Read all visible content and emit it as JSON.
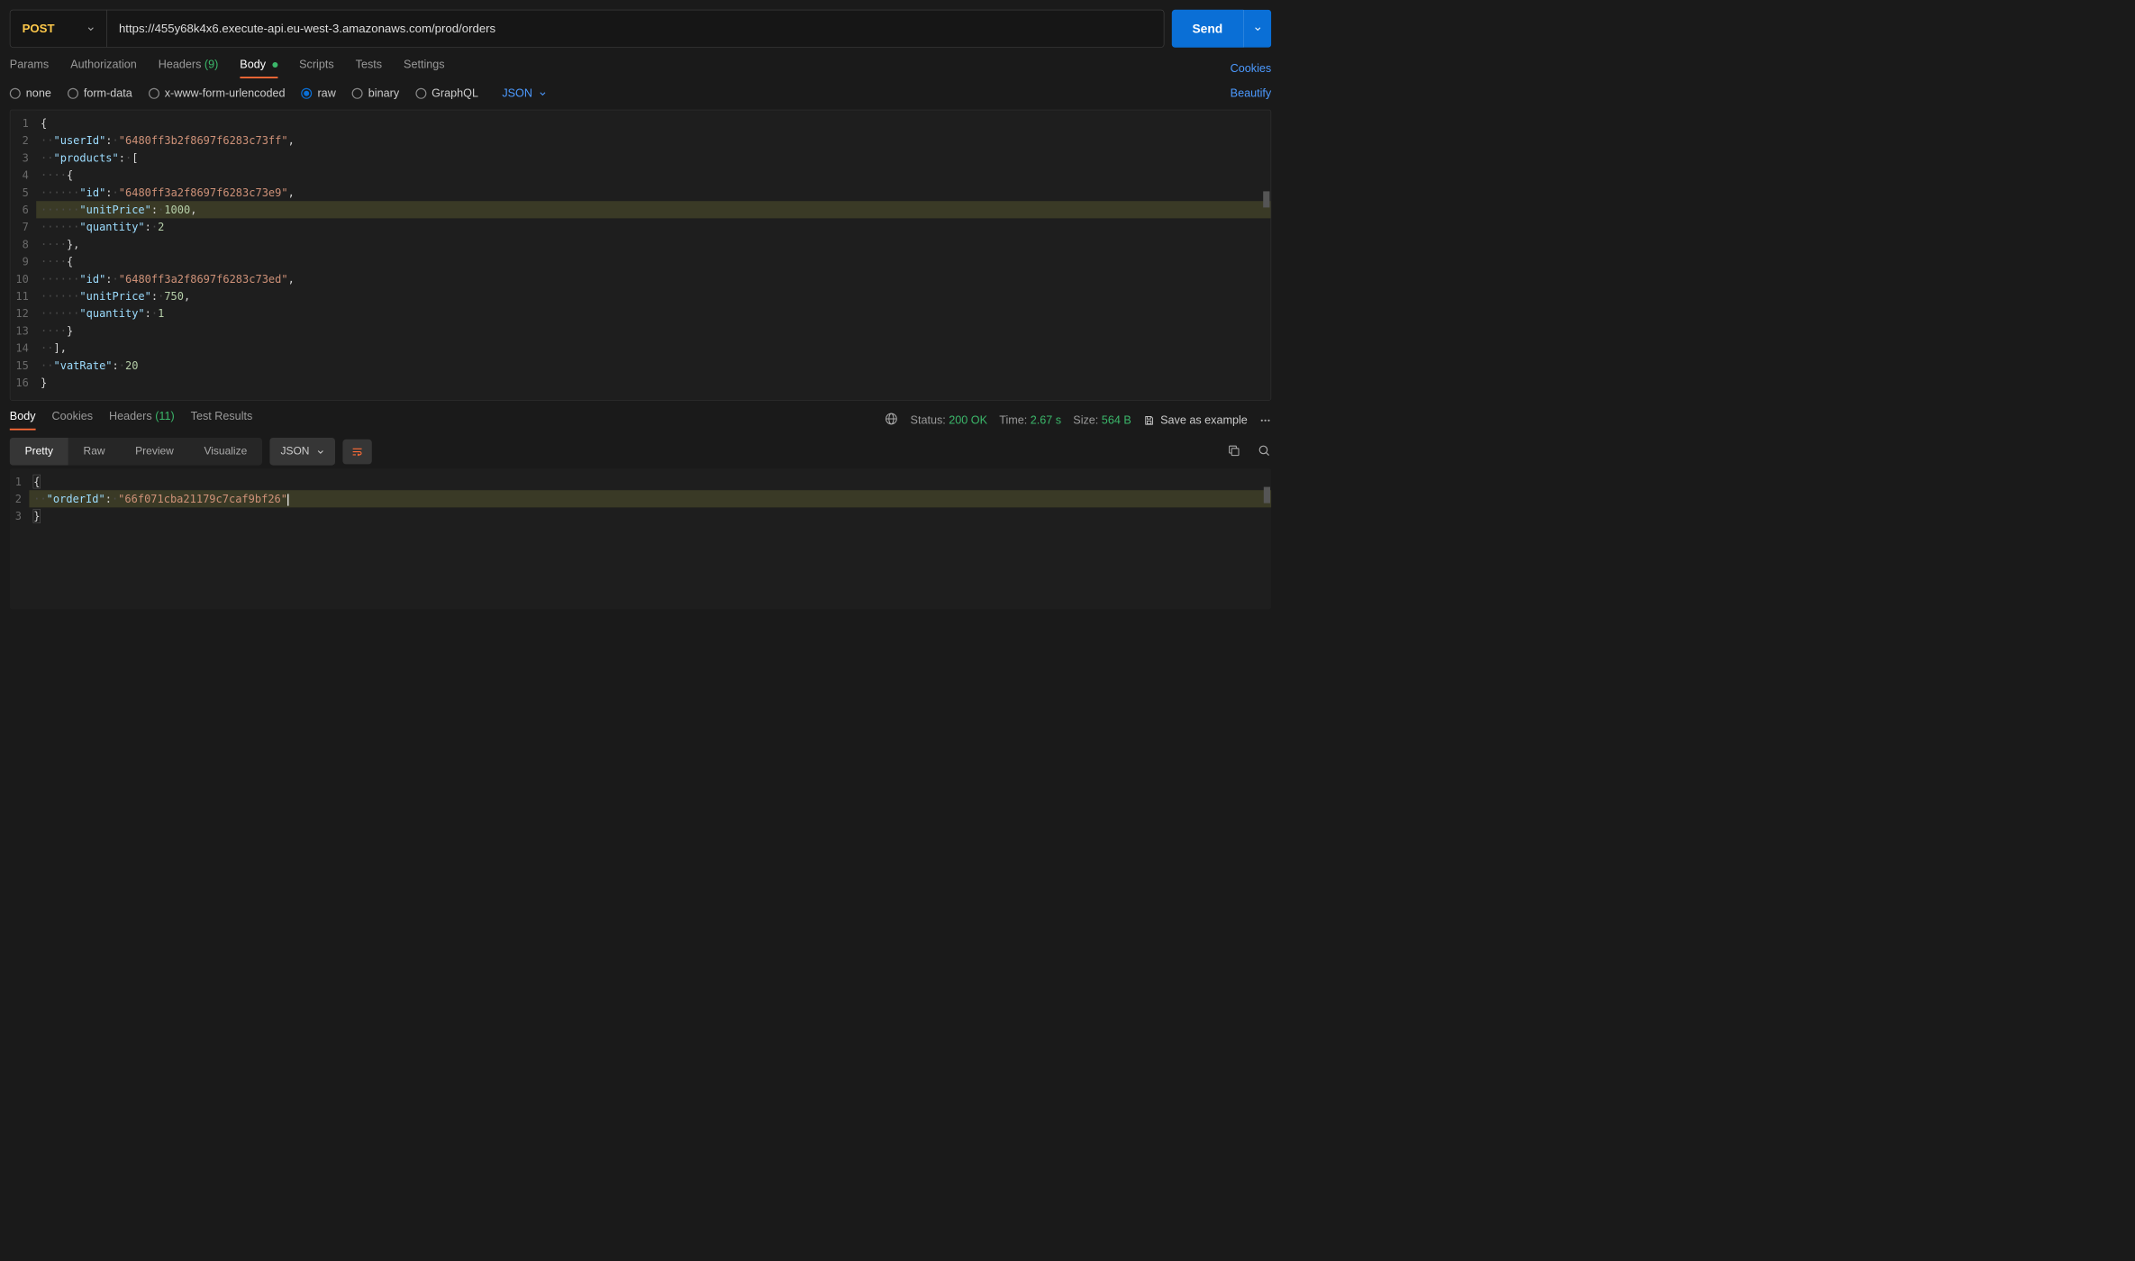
{
  "request": {
    "method": "POST",
    "url": "https://455y68k4x6.execute-api.eu-west-3.amazonaws.com/prod/orders",
    "sendLabel": "Send"
  },
  "requestTabs": {
    "params": "Params",
    "authorization": "Authorization",
    "headers": "Headers",
    "headersCount": "(9)",
    "body": "Body",
    "scripts": "Scripts",
    "tests": "Tests",
    "settings": "Settings",
    "cookiesLink": "Cookies"
  },
  "bodyTypes": {
    "none": "none",
    "formData": "form-data",
    "xwww": "x-www-form-urlencoded",
    "raw": "raw",
    "binary": "binary",
    "graphql": "GraphQL",
    "jsonLabel": "JSON"
  },
  "beautify": "Beautify",
  "requestBodyLines": [
    {
      "n": 1,
      "indent": 0,
      "text": "{",
      "kind": "punc"
    },
    {
      "n": 2,
      "indent": 1,
      "key": "userId",
      "valStr": "6480ff3b2f8697f6283c73ff",
      "comma": true
    },
    {
      "n": 3,
      "indent": 1,
      "key": "products",
      "raw": "[",
      "comma": false
    },
    {
      "n": 4,
      "indent": 2,
      "text": "{",
      "kind": "punc"
    },
    {
      "n": 5,
      "indent": 3,
      "key": "id",
      "valStr": "6480ff3a2f8697f6283c73e9",
      "comma": true
    },
    {
      "n": 6,
      "indent": 3,
      "key": "unitPrice",
      "valNum": "1000",
      "comma": true,
      "hl": true
    },
    {
      "n": 7,
      "indent": 3,
      "key": "quantity",
      "valNum": "2",
      "comma": false
    },
    {
      "n": 8,
      "indent": 2,
      "text": "},",
      "kind": "punc"
    },
    {
      "n": 9,
      "indent": 2,
      "text": "{",
      "kind": "punc"
    },
    {
      "n": 10,
      "indent": 3,
      "key": "id",
      "valStr": "6480ff3a2f8697f6283c73ed",
      "comma": true
    },
    {
      "n": 11,
      "indent": 3,
      "key": "unitPrice",
      "valNum": "750",
      "comma": true
    },
    {
      "n": 12,
      "indent": 3,
      "key": "quantity",
      "valNum": "1",
      "comma": false
    },
    {
      "n": 13,
      "indent": 2,
      "text": "}",
      "kind": "punc"
    },
    {
      "n": 14,
      "indent": 1,
      "text": "],",
      "kind": "punc"
    },
    {
      "n": 15,
      "indent": 1,
      "key": "vatRate",
      "valNum": "20",
      "comma": false
    },
    {
      "n": 16,
      "indent": 0,
      "text": "}",
      "kind": "punc"
    }
  ],
  "responseTabs": {
    "body": "Body",
    "cookies": "Cookies",
    "headers": "Headers",
    "headersCount": "(11)",
    "testResults": "Test Results"
  },
  "status": {
    "statusLabel": "Status:",
    "statusValue": "200 OK",
    "timeLabel": "Time:",
    "timeValue": "2.67 s",
    "sizeLabel": "Size:",
    "sizeValue": "564 B",
    "saveExample": "Save as example"
  },
  "responseToolbar": {
    "pretty": "Pretty",
    "raw": "Raw",
    "preview": "Preview",
    "visualize": "Visualize",
    "json": "JSON"
  },
  "responseBodyLines": [
    {
      "n": 1,
      "indent": 0,
      "text": "{",
      "kind": "punc",
      "box": true
    },
    {
      "n": 2,
      "indent": 1,
      "key": "orderId",
      "valStr": "66f071cba21179c7caf9bf26",
      "comma": false,
      "hl": true,
      "cursor": true
    },
    {
      "n": 3,
      "indent": 0,
      "text": "}",
      "kind": "punc",
      "box": true
    }
  ]
}
